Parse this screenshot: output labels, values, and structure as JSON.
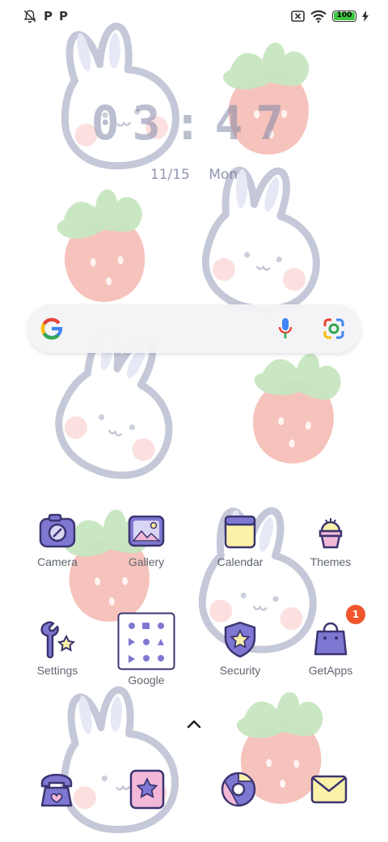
{
  "status_bar": {
    "left_icons": [
      "notifications-off-icon"
    ],
    "left_letters": [
      "P",
      "P"
    ],
    "right_icons": [
      "sim-off-icon",
      "wifi-icon",
      "battery-icon",
      "charging-icon"
    ],
    "battery": "100",
    "battery_color": "#3ec43e"
  },
  "clock": {
    "time": "03:47",
    "date": "11/15 Mon"
  },
  "search": {
    "icons": [
      "google-logo",
      "mic-icon",
      "lens-icon"
    ]
  },
  "apps": [
    {
      "label": "Camera",
      "icon": "camera-icon"
    },
    {
      "label": "Gallery",
      "icon": "gallery-icon"
    },
    {
      "label": "Calendar",
      "icon": "calendar-icon"
    },
    {
      "label": "Themes",
      "icon": "themes-icon"
    },
    {
      "label": "Settings",
      "icon": "settings-icon"
    },
    {
      "label": "Google",
      "icon": "google-folder-icon"
    },
    {
      "label": "Security",
      "icon": "security-icon"
    },
    {
      "label": "GetApps",
      "icon": "getapps-icon"
    }
  ],
  "getapps_badge": "1",
  "dock": [
    "phone-icon",
    "bookmark-star-icon",
    "browser-icon",
    "messages-icon"
  ],
  "colors": {
    "icon_purple": "#7f78d2",
    "icon_outline": "#3b3470",
    "strawberry": "#f4b8b0",
    "leaf": "#c6e6c0",
    "bunny_outline": "#c5c8d8"
  }
}
